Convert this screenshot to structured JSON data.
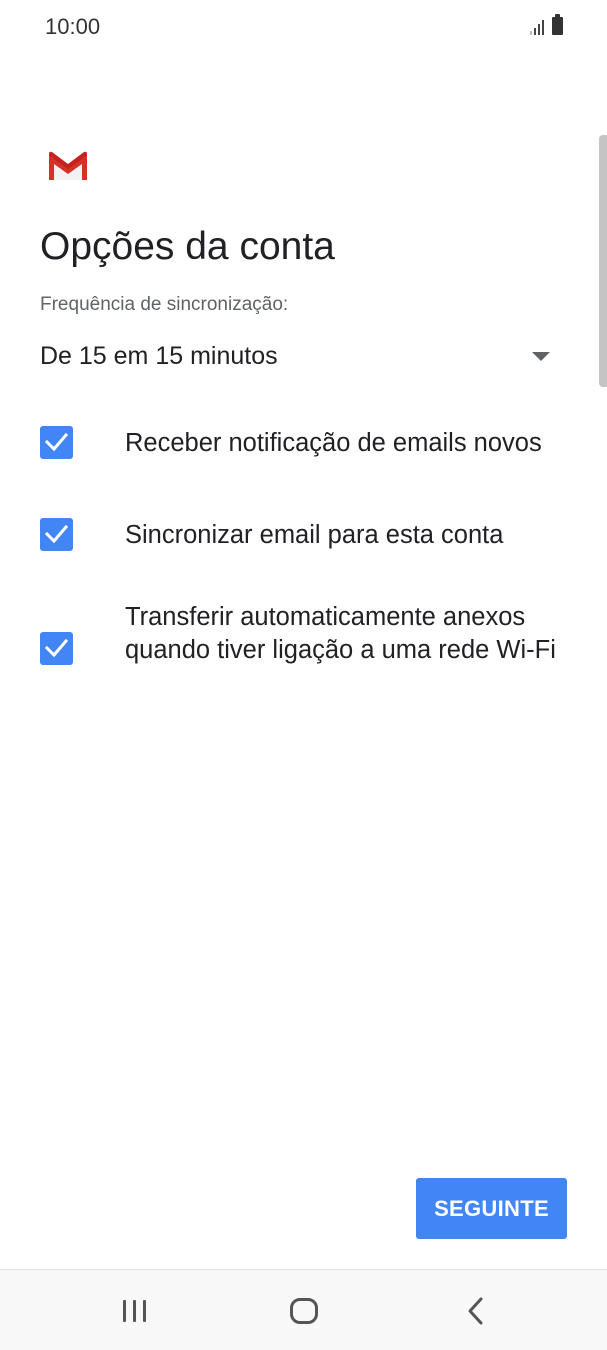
{
  "status_bar": {
    "time": "10:00",
    "icons": [
      "signal-icon",
      "battery-icon"
    ]
  },
  "header": {
    "logo": "gmail-logo-icon",
    "title": "Opções da conta"
  },
  "sync": {
    "label": "Frequência de sincronização:",
    "value": "De 15 em 15 minutos"
  },
  "options": [
    {
      "label": "Receber notificação de emails novos",
      "checked": true
    },
    {
      "label": "Sincronizar email para esta conta",
      "checked": true
    },
    {
      "label": "Transferir automaticamente anexos quando tiver ligação a uma rede Wi-Fi",
      "checked": true
    }
  ],
  "actions": {
    "next_label": "SEGUINTE"
  },
  "colors": {
    "accent": "#4285f4",
    "gmail_red": "#d93025"
  },
  "nav": {
    "icons": [
      "recent-apps-icon",
      "home-icon",
      "back-icon"
    ]
  }
}
